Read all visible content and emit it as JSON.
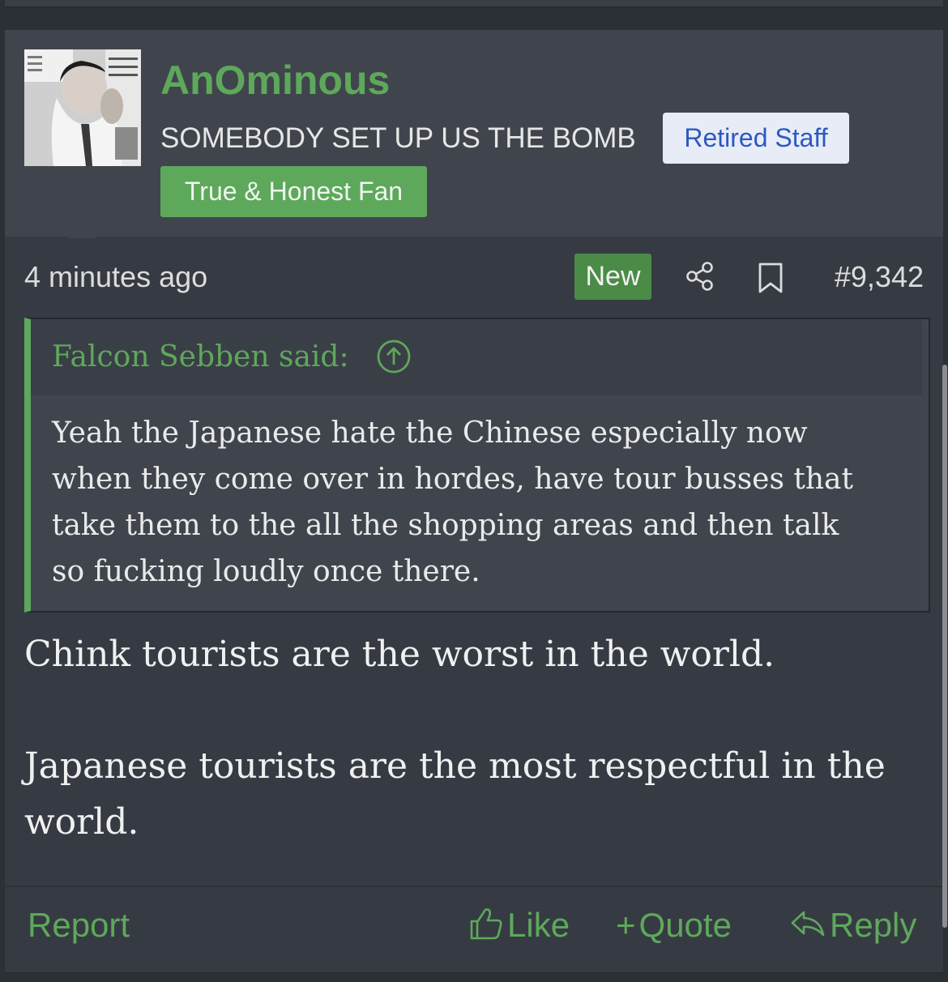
{
  "author": {
    "username": "AnOminous",
    "title": "SOMEBODY SET UP US THE BOMB",
    "badges": {
      "staff": "Retired Staff",
      "fan": "True & Honest Fan"
    }
  },
  "meta": {
    "time": "4 minutes ago",
    "new_label": "New",
    "post_number": "#9,342"
  },
  "quote": {
    "author_line": "Falcon Sebben said:",
    "lines": [
      "Yeah the Japanese hate the Chinese especially now",
      "when they come over in hordes, have tour busses that",
      "take them to the all the shopping areas and then talk",
      "so fucking loudly once there."
    ]
  },
  "message": {
    "line1": "Chink tourists are the worst in the world.",
    "line2a": "Japanese tourists are the most respectful in the",
    "line2b": "world."
  },
  "footer": {
    "report": "Report",
    "like": "Like",
    "quote": "Quote",
    "reply": "Reply"
  },
  "colors": {
    "accent": "#5ea85b",
    "background": "#363b43",
    "header": "#40454d",
    "staff_badge_bg": "#e8ecf7",
    "staff_badge_text": "#2b59c3"
  },
  "icons": [
    "share-icon",
    "bookmark-icon",
    "arrow-up-circle-icon",
    "thumbs-up-icon",
    "reply-arrow-icon"
  ]
}
